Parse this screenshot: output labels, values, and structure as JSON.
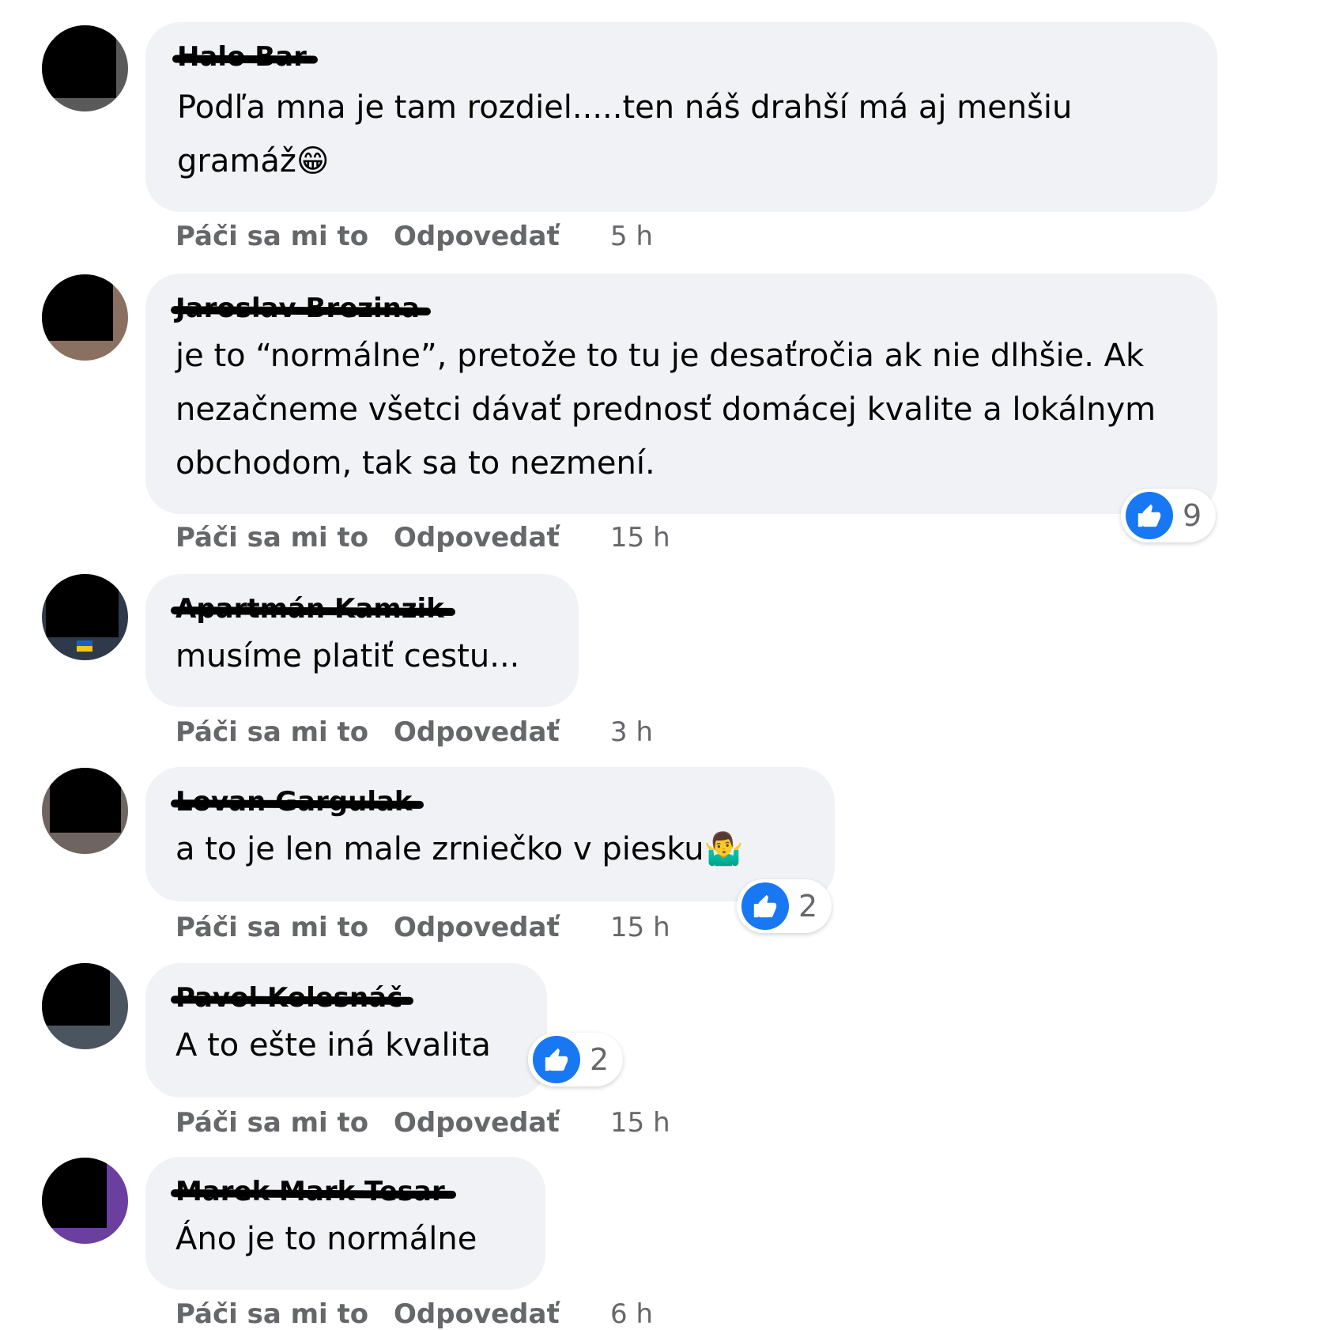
{
  "colors": {
    "bubble": "#f0f2f5",
    "like_blue": "#1877f2",
    "meta_gray": "#65676b",
    "text": "#050505"
  },
  "icons": {
    "reaction": "like-thumb-icon",
    "emoji_grin": "😁",
    "emoji_shrug": "🤷‍♂️"
  },
  "comments": [
    {
      "author": "Halo Bar",
      "text": "Podľa mna je tam rozdiel.....ten náš drahší má aj menšiu gramáž",
      "emoji": "😁",
      "like_label": "Páči sa mi to",
      "reply_label": "Odpovedať",
      "time": "5 h"
    },
    {
      "author": "Jaroslav Brezina",
      "text": "je to “normálne”, pretože to tu je desaťročia ak nie dlhšie. Ak nezačneme všetci dávať prednosť domácej kvalite a lokálnym obchodom, tak sa to nezmení.",
      "like_label": "Páči sa mi to",
      "reply_label": "Odpovedať",
      "time": "15 h",
      "reactions": "9"
    },
    {
      "author": "Apartmán Kamzik",
      "text": "musíme platiť cestu...",
      "like_label": "Páči sa mi to",
      "reply_label": "Odpovedať",
      "time": "3 h"
    },
    {
      "author": "Lovan Gargulak",
      "text": "a to je len male zrniečko v piesku",
      "emoji": "🤷‍♂️",
      "like_label": "Páči sa mi to",
      "reply_label": "Odpovedať",
      "time": "15 h",
      "reactions": "2"
    },
    {
      "author": "Pavol Kolesnáč",
      "text": "A to ešte iná kvalita",
      "like_label": "Páči sa mi to",
      "reply_label": "Odpovedať",
      "time": "15 h",
      "reactions": "2"
    },
    {
      "author": "Marek Mark Tesar",
      "text": "Áno je to normálne",
      "like_label": "Páči sa mi to",
      "reply_label": "Odpovedať",
      "time": "6 h"
    }
  ]
}
